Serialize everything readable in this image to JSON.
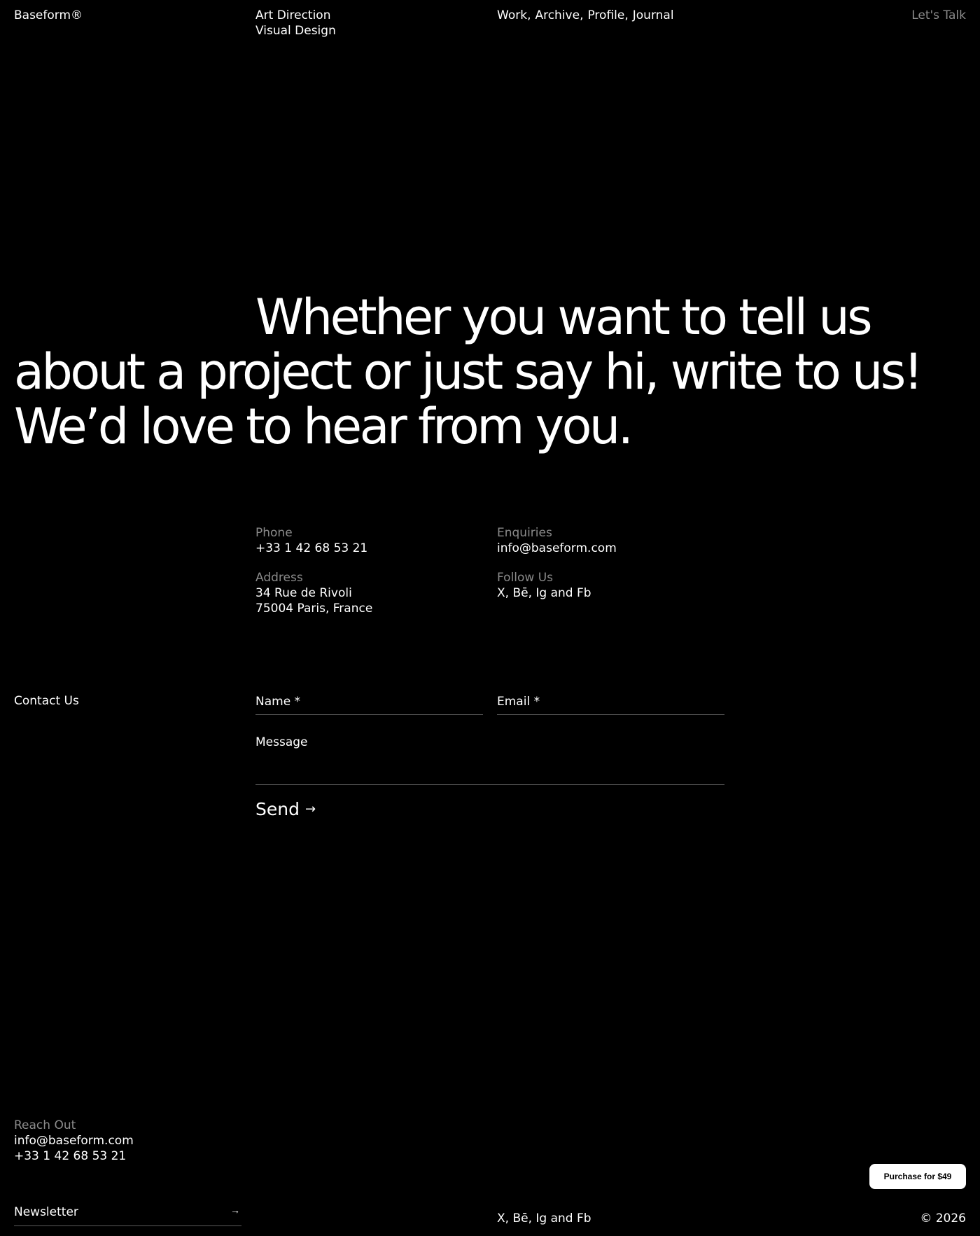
{
  "header": {
    "brand": "Baseform®",
    "services": [
      "Art Direction",
      "Visual Design"
    ],
    "nav": [
      {
        "label": "Work",
        "sep": ","
      },
      {
        "label": "Archive",
        "sep": ","
      },
      {
        "label": "Profile",
        "sep": ","
      },
      {
        "label": "Journal",
        "sep": ""
      }
    ],
    "cta": "Let's Talk"
  },
  "hero": {
    "headline": "Whether you want to tell us about a project or just say hi, write to us! We’d love to hear from you."
  },
  "info": {
    "phone": {
      "label": "Phone",
      "value": "+33 1 42 68 53 21"
    },
    "enquiries": {
      "label": "Enquiries",
      "value": "info@baseform.com"
    },
    "address": {
      "label": "Address",
      "line1": "34 Rue de Rivoli",
      "line2": "75004 Paris, France"
    },
    "follow": {
      "label": "Follow Us",
      "value": "X, Bē, Ig and Fb"
    }
  },
  "form": {
    "title": "Contact Us",
    "name_placeholder": "Name *",
    "email_placeholder": "Email *",
    "message_placeholder": "Message",
    "send_label": "Send",
    "send_arrow": "→"
  },
  "footer": {
    "reach_label": "Reach Out",
    "email": "info@baseform.com",
    "phone": "+33 1 42 68 53 21",
    "newsletter_placeholder": "Newsletter",
    "newsletter_arrow": "→",
    "social": "X, Bē, Ig and Fb",
    "copyright": "© 2026",
    "purchase_label": "Purchase for $49"
  }
}
